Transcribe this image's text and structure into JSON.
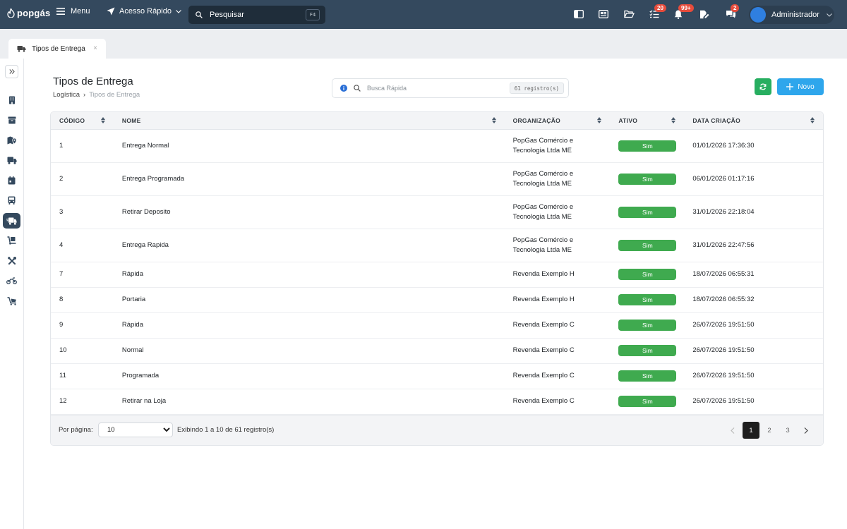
{
  "topbar": {
    "logo_text": "popgás",
    "menu_label": "Menu",
    "quick_access_label": "Acesso Rápido",
    "search_placeholder": "Pesquisar",
    "search_shortcut": "F4",
    "tasks_badge": "20",
    "notifications_badge": "99+",
    "messages_badge": "2",
    "user_name": "Administrador"
  },
  "tabs": [
    {
      "label": "Tipos de Entrega",
      "close": "×"
    }
  ],
  "page": {
    "title": "Tipos de Entrega",
    "breadcrumb_parent": "Logística",
    "breadcrumb_sep": "›",
    "breadcrumb_current": "Tipos de Entrega",
    "quick_search_placeholder": "Busca Rápida",
    "record_count": "61 registro(s)",
    "new_label": "Novo"
  },
  "table": {
    "columns": [
      "CÓDIGO",
      "NOME",
      "ORGANIZAÇÃO",
      "ATIVO",
      "DATA CRIAÇÃO"
    ],
    "rows": [
      {
        "codigo": "1",
        "nome": "Entrega Normal",
        "org_line1": "PopGas Comércio e",
        "org_line2": "Tecnologia Ltda ME",
        "ativo": "Sim",
        "data": "01/01/2026 17:36:30"
      },
      {
        "codigo": "2",
        "nome": "Entrega Programada",
        "org_line1": "PopGas Comércio e",
        "org_line2": "Tecnologia Ltda ME",
        "ativo": "Sim",
        "data": "06/01/2026 01:17:16"
      },
      {
        "codigo": "3",
        "nome": "Retirar Deposito",
        "org_line1": "PopGas Comércio e",
        "org_line2": "Tecnologia Ltda ME",
        "ativo": "Sim",
        "data": "31/01/2026 22:18:04"
      },
      {
        "codigo": "4",
        "nome": "Entrega Rapida",
        "org_line1": "PopGas Comércio e",
        "org_line2": "Tecnologia Ltda ME",
        "ativo": "Sim",
        "data": "31/01/2026 22:47:56"
      },
      {
        "codigo": "7",
        "nome": "Rápida",
        "org_line1": "Revenda Exemplo H",
        "org_line2": "",
        "ativo": "Sim",
        "data": "18/07/2026 06:55:31"
      },
      {
        "codigo": "8",
        "nome": "Portaria",
        "org_line1": "Revenda Exemplo H",
        "org_line2": "",
        "ativo": "Sim",
        "data": "18/07/2026 06:55:32"
      },
      {
        "codigo": "9",
        "nome": "Rápida",
        "org_line1": "Revenda Exemplo C",
        "org_line2": "",
        "ativo": "Sim",
        "data": "26/07/2026 19:51:50"
      },
      {
        "codigo": "10",
        "nome": "Normal",
        "org_line1": "Revenda Exemplo C",
        "org_line2": "",
        "ativo": "Sim",
        "data": "26/07/2026 19:51:50"
      },
      {
        "codigo": "11",
        "nome": "Programada",
        "org_line1": "Revenda Exemplo C",
        "org_line2": "",
        "ativo": "Sim",
        "data": "26/07/2026 19:51:50"
      },
      {
        "codigo": "12",
        "nome": "Retirar na Loja",
        "org_line1": "Revenda Exemplo C",
        "org_line2": "",
        "ativo": "Sim",
        "data": "26/07/2026 19:51:50"
      }
    ]
  },
  "footer": {
    "per_page_label": "Por página:",
    "per_page_value": "10",
    "info": "Exibindo 1 a 10 de 61 registro(s)",
    "pages": [
      "1",
      "2",
      "3"
    ],
    "current_page": "1"
  },
  "colors": {
    "topbar": "#34495e",
    "active_pill": "#3faa4f",
    "new_button": "#2ea6ec",
    "refresh_button": "#27ae60",
    "badge": "#e74c3c"
  },
  "sidebar_icons": [
    "building-icon",
    "box-icon",
    "map-pin-icon",
    "truck-icon",
    "calendar-icon",
    "bus-icon",
    "delivery-truck-icon",
    "dolly-icon",
    "tools-icon",
    "motorcycle-icon",
    "cart-icon"
  ]
}
